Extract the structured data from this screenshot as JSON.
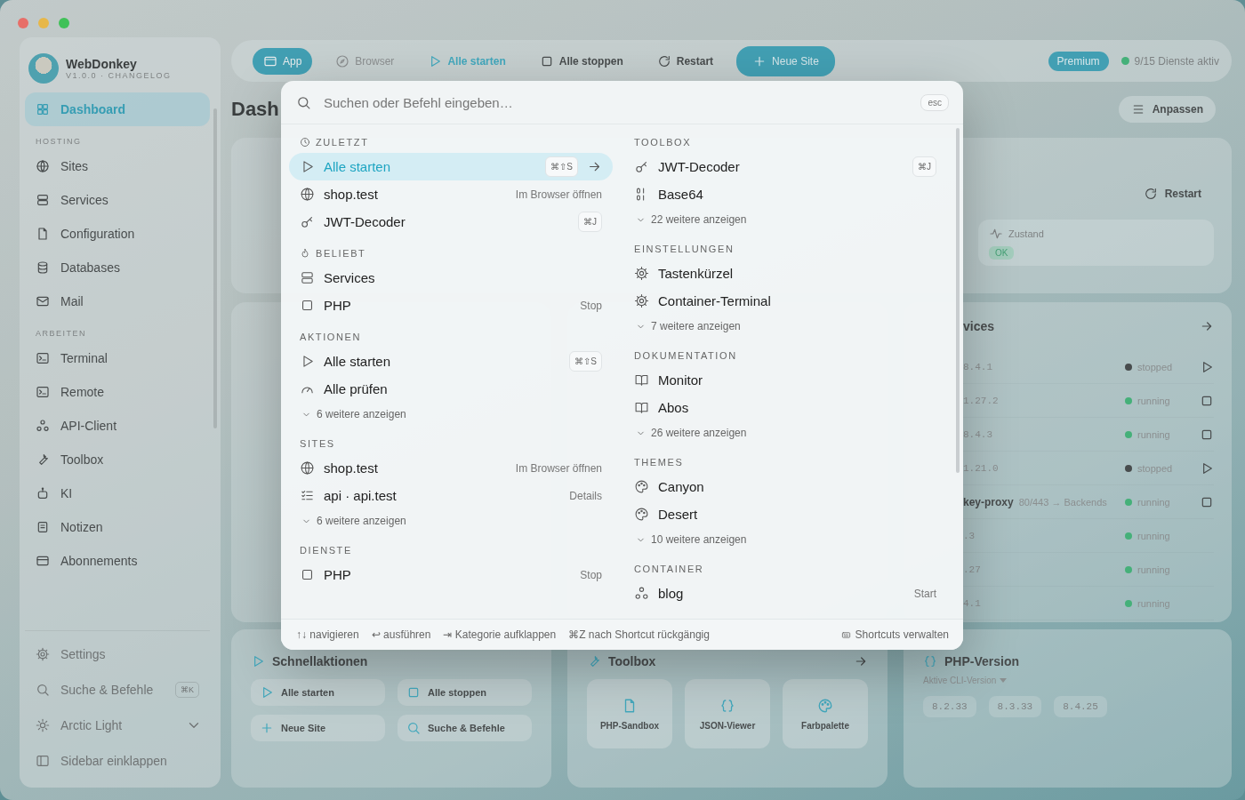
{
  "sidebar": {
    "app_name": "WebDonkey",
    "version": "V1.0.0 · CHANGELOG",
    "top": [
      {
        "label": "Dashboard",
        "kind": "grid",
        "selected": true
      }
    ],
    "sections": [
      {
        "title": "HOSTING",
        "items": [
          {
            "label": "Sites",
            "kind": "globe",
            "selected": false
          },
          {
            "label": "Services",
            "kind": "server",
            "selected": false
          },
          {
            "label": "Configuration",
            "kind": "file",
            "selected": false
          },
          {
            "label": "Databases",
            "kind": "database",
            "selected": false
          },
          {
            "label": "Mail",
            "kind": "mail",
            "selected": false
          }
        ]
      },
      {
        "title": "ARBEITEN",
        "items": [
          {
            "label": "Terminal",
            "kind": "terminal",
            "selected": false
          },
          {
            "label": "Remote",
            "kind": "terminal",
            "selected": false
          },
          {
            "label": "API-Client",
            "kind": "network",
            "selected": false
          },
          {
            "label": "Toolbox",
            "kind": "wrench",
            "selected": false
          },
          {
            "label": "KI",
            "kind": "robot",
            "selected": false
          },
          {
            "label": "Notizen",
            "kind": "note",
            "selected": false
          },
          {
            "label": "Abonnements",
            "kind": "card",
            "selected": false
          }
        ]
      }
    ],
    "footer": [
      {
        "label": "Settings",
        "kind": "gear"
      },
      {
        "label": "Suche & Befehle",
        "kind": "search",
        "shortcut": "⌘K"
      },
      {
        "label": "Arctic Light",
        "kind": "sun",
        "caret": true
      },
      {
        "label": "Sidebar einklappen",
        "kind": "sidebar"
      }
    ]
  },
  "toolbar": {
    "tabs": [
      {
        "label": "App",
        "kind": "window",
        "selected": true
      },
      {
        "label": "Browser",
        "kind": "compass",
        "selected": false
      }
    ],
    "actions": [
      {
        "label": "Alle starten",
        "kind": "play",
        "accent": true
      },
      {
        "label": "Alle stoppen",
        "kind": "square",
        "accent": false
      },
      {
        "label": "Restart",
        "kind": "refresh",
        "accent": false
      }
    ],
    "primary": {
      "label": "Neue Site",
      "kind": "plus"
    },
    "plan": "Premium",
    "status": "9/15 Dienste aktiv"
  },
  "dashboard": {
    "title": "Dash",
    "customize": "Anpassen",
    "restart": "Restart",
    "health": {
      "label": "Zustand",
      "value": "OK"
    },
    "services": {
      "title": "vices",
      "rows": [
        {
          "version": "8.4.1",
          "running": false,
          "status": "stopped",
          "kind": "play"
        },
        {
          "version": "1.27.2",
          "running": true,
          "status": "running",
          "kind": "stop"
        },
        {
          "version": "8.4.3",
          "running": true,
          "status": "running",
          "kind": "stop"
        },
        {
          "version": "1.21.0",
          "running": false,
          "status": "stopped",
          "kind": "play"
        },
        {
          "name": "key-proxy",
          "detail": "80/443 → Backends",
          "running": true,
          "status": "running",
          "kind": "stop"
        },
        {
          "version": ".3",
          "running": true,
          "status": "running"
        },
        {
          "version": ".27",
          "running": true,
          "status": "running"
        },
        {
          "version": "4.1",
          "running": true,
          "status": "running"
        }
      ]
    },
    "quick_actions": {
      "title": "Schnellaktionen",
      "buttons": [
        {
          "label": "Alle starten",
          "kind": "play"
        },
        {
          "label": "Alle stoppen",
          "kind": "square"
        },
        {
          "label": "Neue Site",
          "kind": "plus"
        },
        {
          "label": "Suche & Befehle",
          "kind": "search"
        }
      ]
    },
    "toolbox": {
      "title": "Toolbox",
      "tools": [
        {
          "label": "PHP-Sandbox",
          "kind": "file"
        },
        {
          "label": "JSON-Viewer",
          "kind": "braces"
        },
        {
          "label": "Farbpalette",
          "kind": "palette"
        }
      ]
    },
    "php_version": {
      "title": "PHP-Version",
      "label": "Aktive CLI-Version",
      "versions": [
        "8.2.33",
        "8.3.33",
        "8.4.25"
      ]
    }
  },
  "palette": {
    "search": {
      "placeholder": "Suchen oder Befehl eingeben…",
      "key": "esc"
    },
    "columns": [
      [
        {
          "title": "ZULETZT",
          "kind": "clock",
          "items": [
            {
              "label": "Alle starten",
              "kind": "play",
              "shortcut": "⌘⇧S",
              "selected": true
            },
            {
              "label": "shop.test",
              "kind": "globe",
              "hint": "Im Browser öffnen",
              "selected": false
            },
            {
              "label": "JWT-Decoder",
              "kind": "key",
              "shortcut": "⌘J",
              "selected": false
            }
          ]
        },
        {
          "title": "BELIEBT",
          "kind": "flame",
          "items": [
            {
              "label": "Services",
              "kind": "server",
              "selected": false
            },
            {
              "label": "PHP",
              "kind": "square",
              "hint": "Stop",
              "selected": false
            }
          ]
        },
        {
          "title": "AKTIONEN",
          "items": [
            {
              "label": "Alle starten",
              "kind": "play",
              "shortcut": "⌘⇧S",
              "selected": false
            },
            {
              "label": "Alle prüfen",
              "kind": "gauge",
              "selected": false
            }
          ],
          "more": "6 weitere anzeigen"
        },
        {
          "title": "SITES",
          "items": [
            {
              "label": "shop.test",
              "kind": "globe",
              "hint": "Im Browser öffnen",
              "selected": false
            },
            {
              "label": "api · api.test",
              "kind": "list",
              "hint": "Details",
              "selected": false
            }
          ],
          "more": "6 weitere anzeigen"
        },
        {
          "title": "DIENSTE",
          "items": [
            {
              "label": "PHP",
              "kind": "square",
              "hint": "Stop",
              "selected": false
            }
          ]
        }
      ],
      [
        {
          "title": "TOOLBOX",
          "items": [
            {
              "label": "JWT-Decoder",
              "kind": "key",
              "shortcut": "⌘J",
              "selected": false
            },
            {
              "label": "Base64",
              "kind": "binary",
              "selected": false
            }
          ],
          "more": "22 weitere anzeigen"
        },
        {
          "title": "EINSTELLUNGEN",
          "items": [
            {
              "label": "Tastenkürzel",
              "kind": "gear",
              "selected": false
            },
            {
              "label": "Container-Terminal",
              "kind": "gear",
              "selected": false
            }
          ],
          "more": "7 weitere anzeigen"
        },
        {
          "title": "DOKUMENTATION",
          "items": [
            {
              "label": "Monitor",
              "kind": "book",
              "selected": false
            },
            {
              "label": "Abos",
              "kind": "book",
              "selected": false
            }
          ],
          "more": "26 weitere anzeigen"
        },
        {
          "title": "THEMES",
          "items": [
            {
              "label": "Canyon",
              "kind": "palette",
              "selected": false
            },
            {
              "label": "Desert",
              "kind": "palette",
              "selected": false
            }
          ],
          "more": "10 weitere anzeigen"
        },
        {
          "title": "CONTAINER",
          "items": [
            {
              "label": "blog",
              "kind": "network",
              "hint": "Start",
              "selected": false
            }
          ]
        }
      ]
    ],
    "footer": {
      "hints": [
        "↑↓ navigieren",
        "↩ ausführen",
        "⇥ Kategorie aufklappen",
        "⌘Z nach Shortcut rückgängig"
      ],
      "manage": "Shortcuts verwalten"
    }
  }
}
